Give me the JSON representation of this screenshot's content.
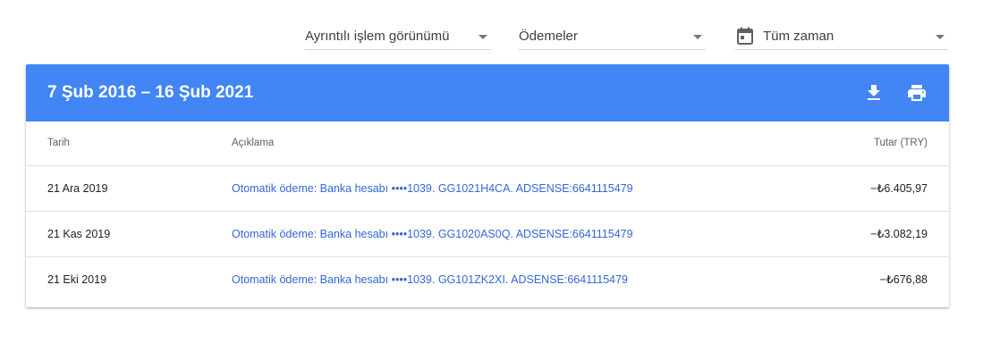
{
  "filters": {
    "view": {
      "label": "Ayrıntılı işlem görünümü",
      "icon": "chevron-down-icon"
    },
    "type": {
      "label": "Ödemeler",
      "icon": "chevron-down-icon"
    },
    "time": {
      "label": "Tüm zaman",
      "icon": "calendar-icon"
    }
  },
  "card": {
    "title": "7 Şub 2016 – 16 Şub 2021",
    "header_color": "#4285f4",
    "actions": [
      "download-icon",
      "print-icon"
    ]
  },
  "table": {
    "headers": {
      "date": "Tarih",
      "description": "Açıklama",
      "amount": "Tutar (TRY)"
    },
    "rows": [
      {
        "date": "21 Ara 2019",
        "description": "Otomatik ödeme: Banka hesabı  ••••1039. GG1021H4CA. ADSENSE:6641115479",
        "amount": "−₺6.405,97"
      },
      {
        "date": "21 Kas 2019",
        "description": "Otomatik ödeme: Banka hesabı  ••••1039. GG1020AS0Q. ADSENSE:6641115479",
        "amount": "−₺3.082,19"
      },
      {
        "date": "21 Eki 2019",
        "description": "Otomatik ödeme: Banka hesabı  ••••1039. GG101ZK2XI. ADSENSE:6641115479",
        "amount": "−₺676,88"
      }
    ]
  },
  "colors": {
    "accent": "#4285f4",
    "link": "#3367d6"
  }
}
